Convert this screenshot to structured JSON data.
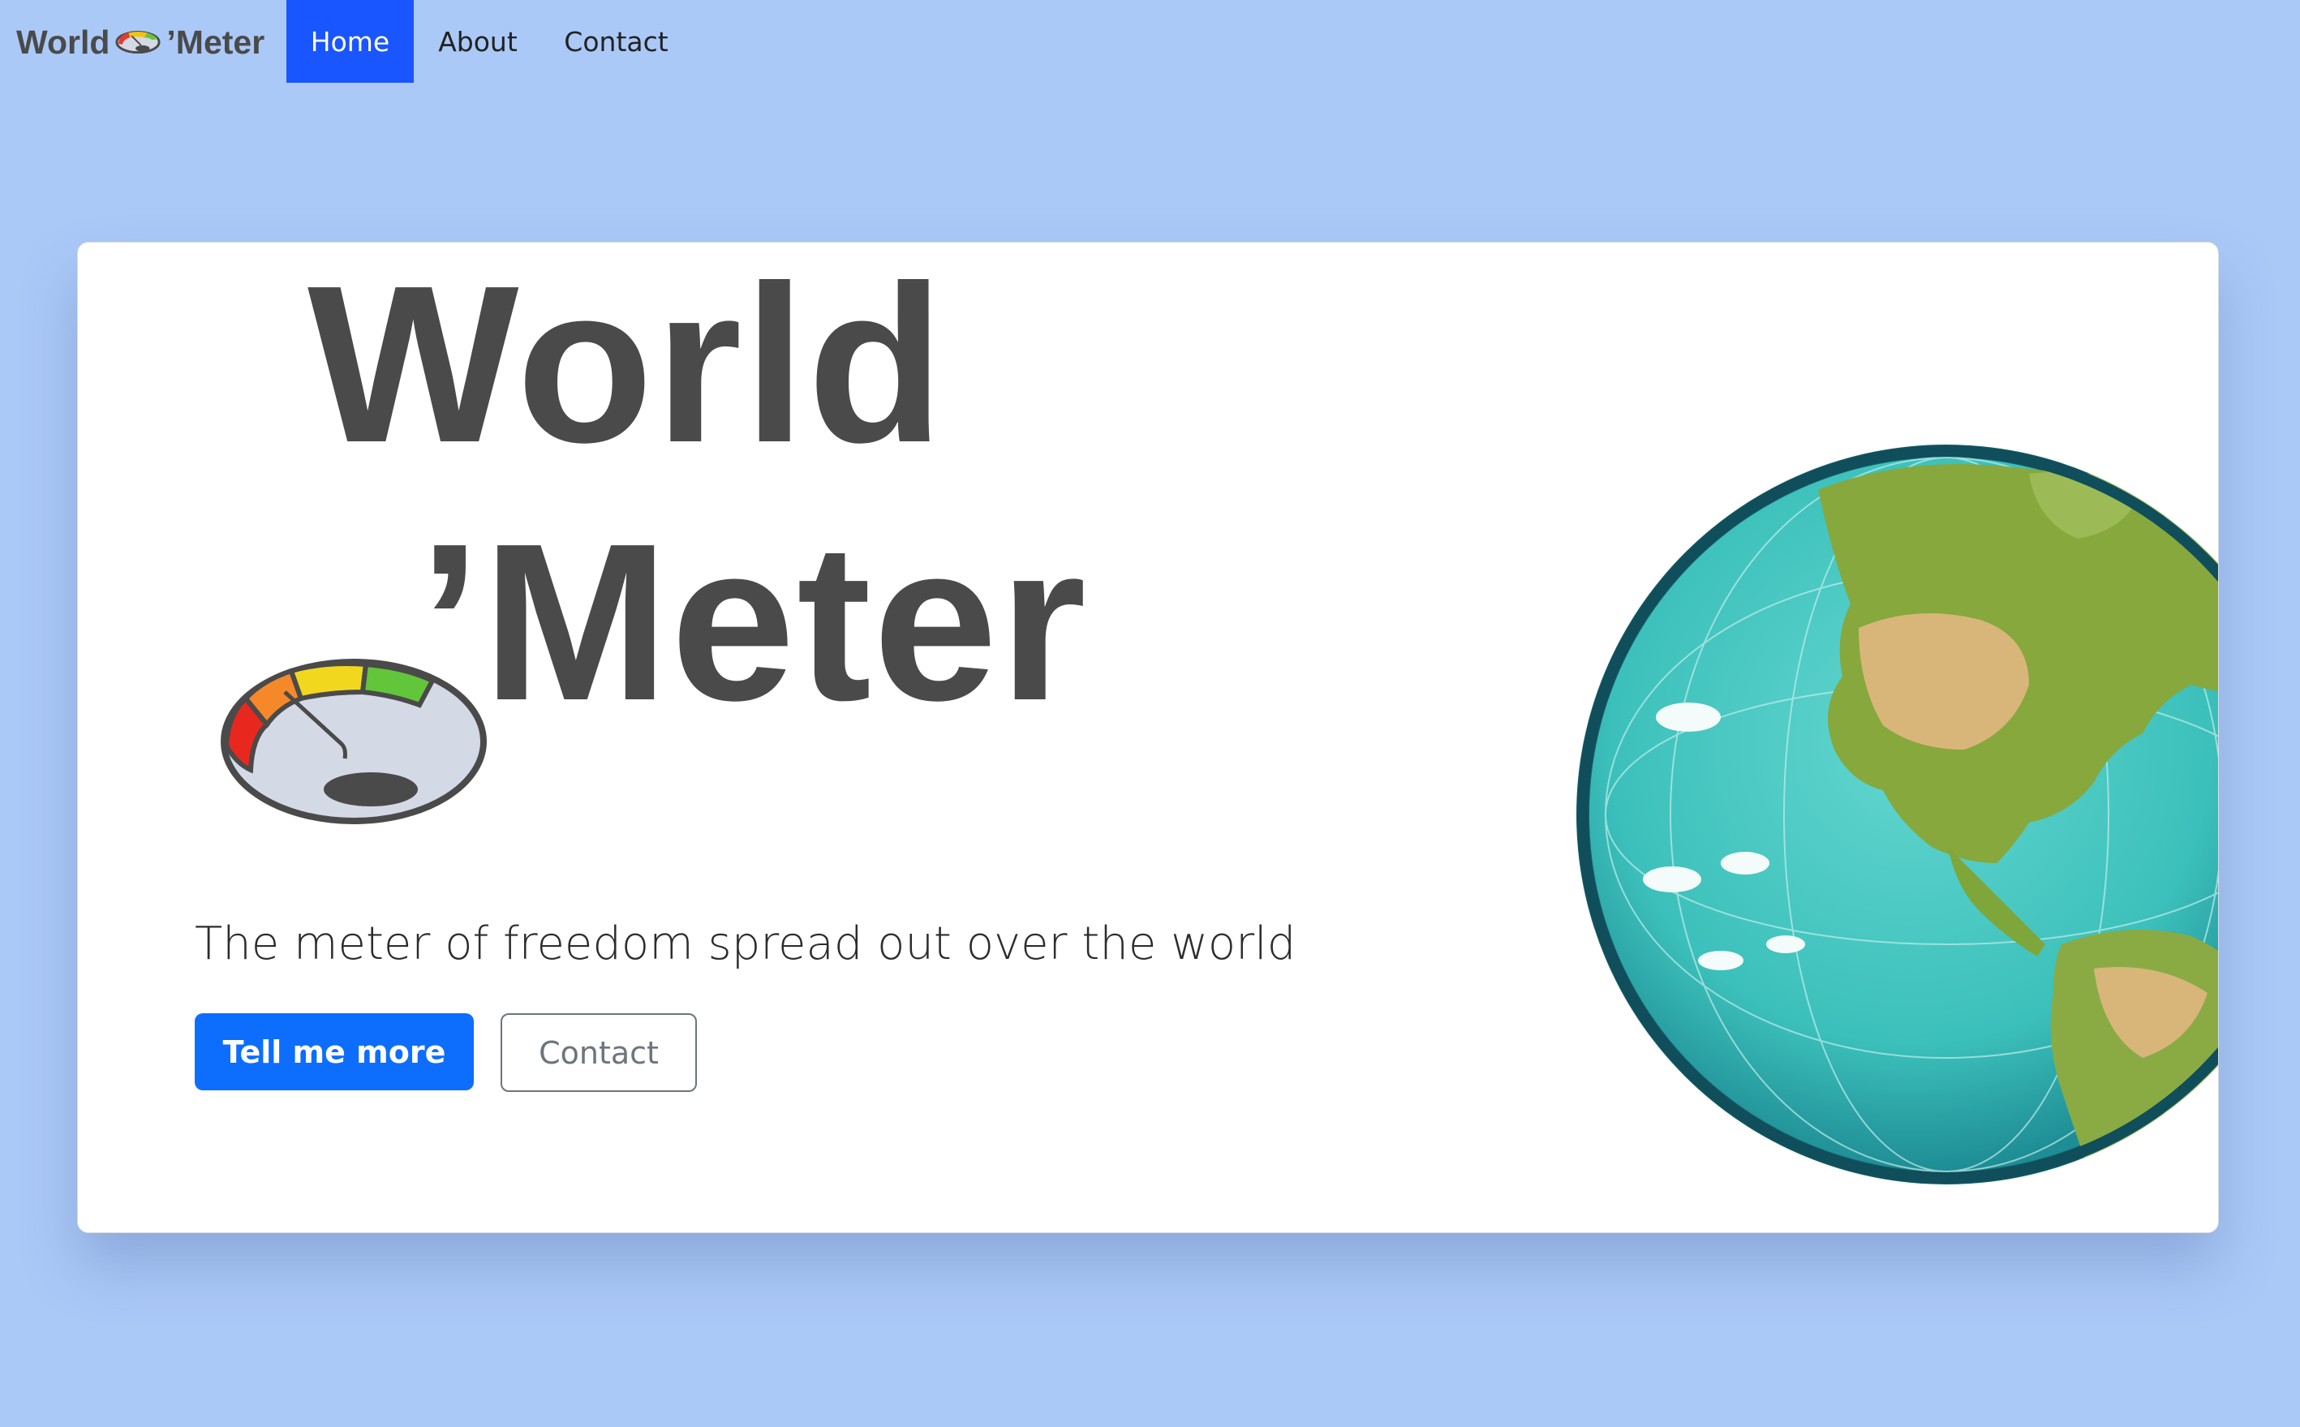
{
  "navbar": {
    "brand": "World 'Meter",
    "brand_word1": "World",
    "brand_word2": "’Meter",
    "items": [
      {
        "label": "Home",
        "active": true
      },
      {
        "label": "About",
        "active": false
      },
      {
        "label": "Contact",
        "active": false
      }
    ]
  },
  "hero": {
    "logo_word1": "World",
    "logo_word2": "’Meter",
    "tagline": "The meter of freedom spread out over the world",
    "primary_button": "Tell me more",
    "secondary_button": "Contact"
  },
  "colors": {
    "background": "#abc9f7",
    "nav_active": "#1a56ff",
    "primary": "#0d6efd",
    "text_dark": "#4a4a4a",
    "ocean": "#3fc3c0",
    "land_green": "#7ea63a",
    "land_tan": "#d8b77a"
  },
  "icons": [
    "gauge-icon",
    "globe-image"
  ]
}
